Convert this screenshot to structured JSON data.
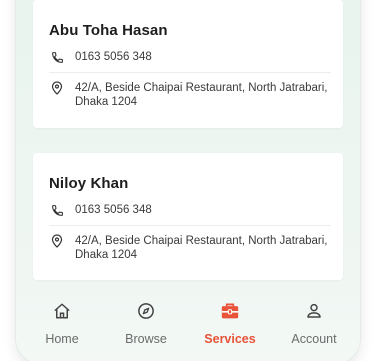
{
  "contacts": [
    {
      "name": "Abu Toha Hasan",
      "phone": "0163 5056 348",
      "address": "42/A, Beside Chaipai Restaurant, North Jatrabari, Dhaka 1204"
    },
    {
      "name": "Niloy Khan",
      "phone": "0163 5056 348",
      "address": "42/A, Beside Chaipai Restaurant, North Jatrabari, Dhaka 1204"
    }
  ],
  "tabs": [
    {
      "label": "Home",
      "icon": "home-icon",
      "active": false
    },
    {
      "label": "Browse",
      "icon": "compass-icon",
      "active": false
    },
    {
      "label": "Services",
      "icon": "toolbox-icon",
      "active": true
    },
    {
      "label": "Account",
      "icon": "user-icon",
      "active": false
    }
  ],
  "colors": {
    "accent": "#e8533a",
    "inactive": "#6b6b6b",
    "background": "#e9f4ee"
  }
}
